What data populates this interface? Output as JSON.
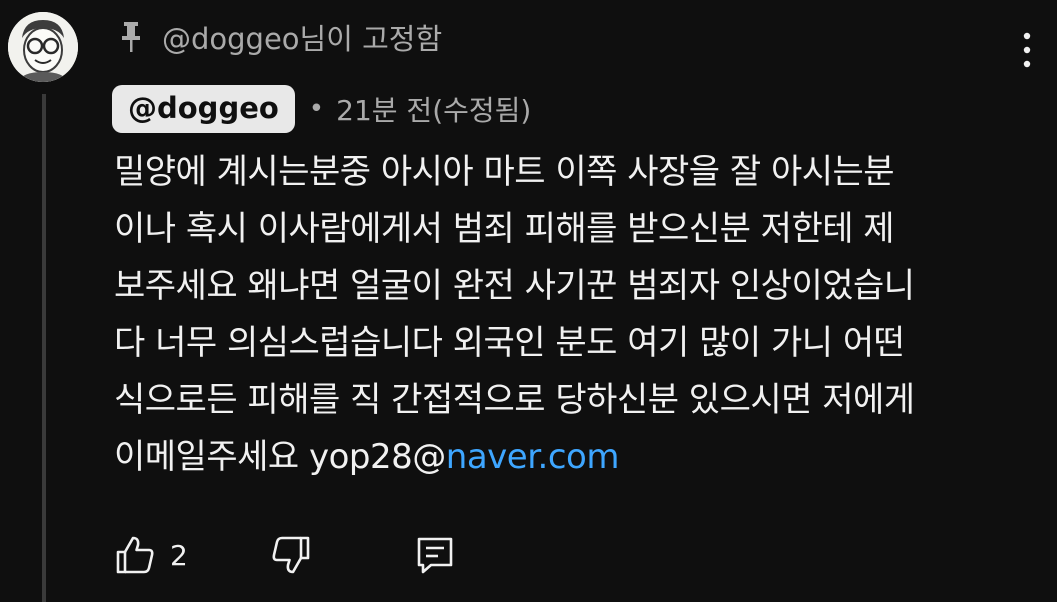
{
  "comment": {
    "pinned_text": "@doggeo님이 고정함",
    "author": "@doggeo",
    "meta_separator": "•",
    "time": "21분 전(수정됨)",
    "body_text": "밀양에 계시는분중 아시아 마트 이쪽 사장을 잘 아시는분\n이나 혹시 이사람에게서 범죄 피해를 받으신분 저한테 제\n보주세요 왜냐면 얼굴이 완전 사기꾼 범죄자 인상이었습니\n다 너무 의심스럽습니다 외국인 분도 여기 많이 가니 어떤\n식으로든 피해를 직 간접적으로 당하신분 있으시면 저에게\n이메일주세요 yop28@",
    "link_text": "naver.com",
    "like_count": "2"
  },
  "icons": {
    "pin": "pin-icon",
    "more": "more-vert-icon",
    "like": "thumbs-up-icon",
    "dislike": "thumbs-down-icon",
    "reply": "reply-icon"
  },
  "colors": {
    "background": "#0f0f0f",
    "link": "#3ea6ff",
    "author_chip": "#e8e8e8",
    "secondary_text": "#aaaaaa"
  }
}
